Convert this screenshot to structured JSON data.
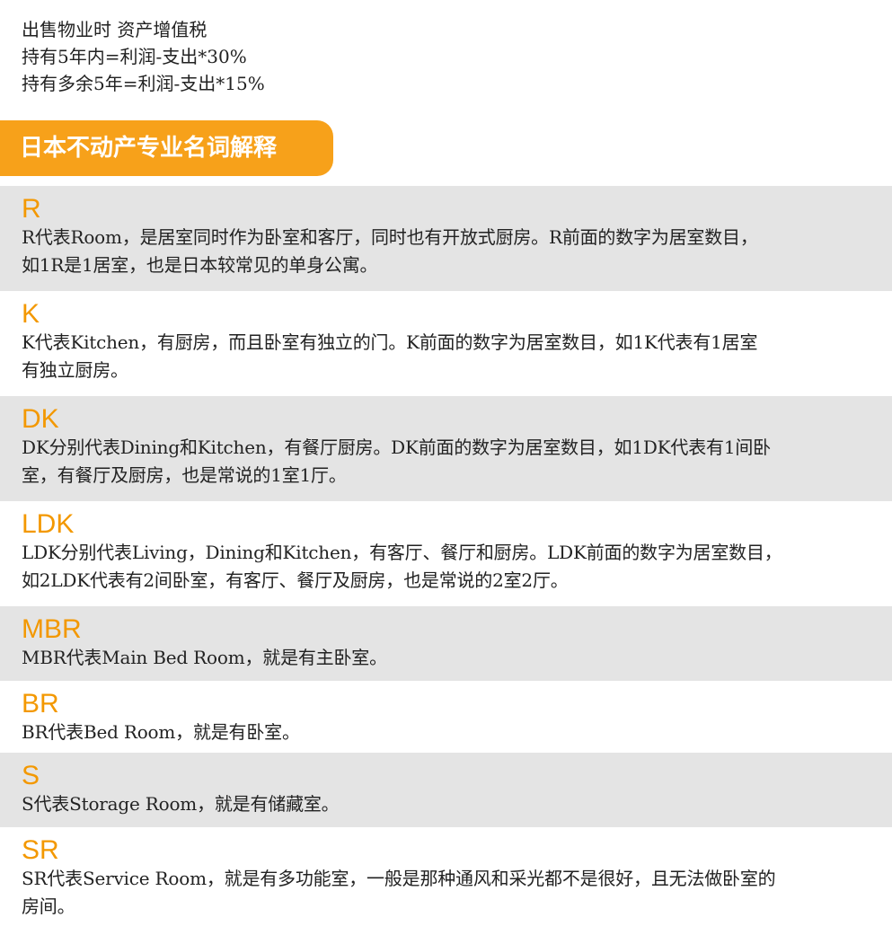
{
  "intro": {
    "lines": [
      "出售物业时 资产增值税",
      "持有5年内=利润-支出*30%",
      "持有多余5年=利润-支出*15%"
    ]
  },
  "section_title": "日本不动产专业名词解释",
  "colors": {
    "accent": "#f7a11a",
    "term_code": "#f39800",
    "shaded_row": "#e4e4e4"
  },
  "terms": [
    {
      "code": "R",
      "desc_lines": [
        "R代表Room，是居室同时作为卧室和客厅，同时也有开放式厨房。R前面的数字为居室数目，",
        "如1R是1居室，也是日本较常见的单身公寓。"
      ]
    },
    {
      "code": "K",
      "desc_lines": [
        "K代表Kitchen，有厨房，而且卧室有独立的门。K前面的数字为居室数目，如1K代表有1居室",
        "有独立厨房。"
      ]
    },
    {
      "code": "DK",
      "desc_lines": [
        "DK分别代表Dining和Kitchen，有餐厅厨房。DK前面的数字为居室数目，如1DK代表有1间卧",
        "室，有餐厅及厨房，也是常说的1室1厅。"
      ]
    },
    {
      "code": "LDK",
      "desc_lines": [
        "LDK分别代表Living，Dining和Kitchen，有客厅、餐厅和厨房。LDK前面的数字为居室数目，",
        "如2LDK代表有2间卧室，有客厅、餐厅及厨房，也是常说的2室2厅。"
      ]
    },
    {
      "code": "MBR",
      "desc_lines": [
        "MBR代表Main Bed Room，就是有主卧室。"
      ]
    },
    {
      "code": "BR",
      "desc_lines": [
        "BR代表Bed Room，就是有卧室。"
      ]
    },
    {
      "code": "S",
      "desc_lines": [
        "S代表Storage Room，就是有储藏室。"
      ]
    },
    {
      "code": "SR",
      "desc_lines": [
        "SR代表Service Room，就是有多功能室，一般是那种通风和采光都不是很好，且无法做卧室的",
        "房间。"
      ]
    }
  ]
}
